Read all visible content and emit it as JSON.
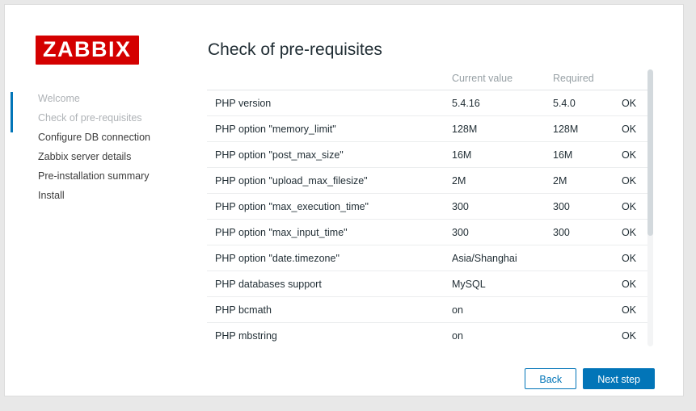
{
  "brand": {
    "logo_text": "ZABBIX",
    "logo_bg_color": "#d40000",
    "accent_color": "#0275b8",
    "status_ok_color": "#59a659"
  },
  "sidebar": {
    "steps": [
      {
        "label": "Welcome",
        "state": "done"
      },
      {
        "label": "Check of pre-requisites",
        "state": "done"
      },
      {
        "label": "Configure DB connection",
        "state": "pending"
      },
      {
        "label": "Zabbix server details",
        "state": "pending"
      },
      {
        "label": "Pre-installation summary",
        "state": "pending"
      },
      {
        "label": "Install",
        "state": "pending"
      }
    ]
  },
  "main": {
    "title": "Check of pre-requisites",
    "table": {
      "headers": [
        "",
        "Current value",
        "Required",
        ""
      ],
      "rows": [
        {
          "name": "PHP version",
          "current": "5.4.16",
          "required": "5.4.0",
          "status": "OK"
        },
        {
          "name": "PHP option \"memory_limit\"",
          "current": "128M",
          "required": "128M",
          "status": "OK"
        },
        {
          "name": "PHP option \"post_max_size\"",
          "current": "16M",
          "required": "16M",
          "status": "OK"
        },
        {
          "name": "PHP option \"upload_max_filesize\"",
          "current": "2M",
          "required": "2M",
          "status": "OK"
        },
        {
          "name": "PHP option \"max_execution_time\"",
          "current": "300",
          "required": "300",
          "status": "OK"
        },
        {
          "name": "PHP option \"max_input_time\"",
          "current": "300",
          "required": "300",
          "status": "OK"
        },
        {
          "name": "PHP option \"date.timezone\"",
          "current": "Asia/Shanghai",
          "required": "",
          "status": "OK"
        },
        {
          "name": "PHP databases support",
          "current": "MySQL",
          "required": "",
          "status": "OK"
        },
        {
          "name": "PHP bcmath",
          "current": "on",
          "required": "",
          "status": "OK"
        },
        {
          "name": "PHP mbstring",
          "current": "on",
          "required": "",
          "status": "OK"
        }
      ]
    },
    "scrollbar": {
      "thumb_percent": 60
    }
  },
  "footer": {
    "back_label": "Back",
    "next_label": "Next step"
  }
}
